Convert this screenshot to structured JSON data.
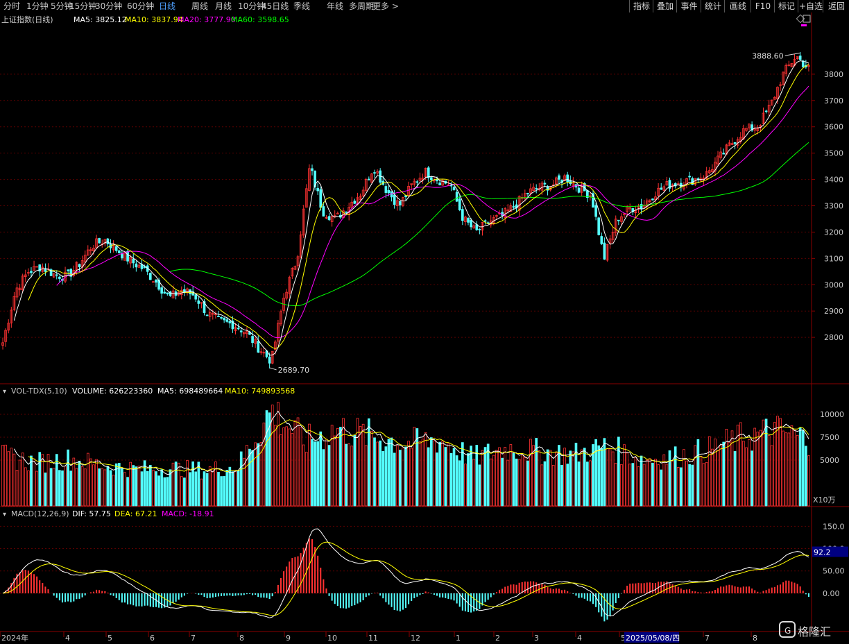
{
  "toolbar": {
    "periods": [
      "分时",
      "1分钟",
      "5分钟",
      "15分钟",
      "30分钟",
      "60分钟",
      "日线",
      "周线",
      "月线",
      "10分钟",
      "45日线",
      "季线",
      "年线",
      "多周期",
      "更多 >"
    ],
    "active_period": "日线",
    "right_buttons": [
      "指标",
      "叠加",
      "事件",
      "统计",
      "画线",
      "F10",
      "标记",
      "+自选",
      "返回"
    ]
  },
  "colors": {
    "up": "#ff3232",
    "down": "#54ffff",
    "ma5": "#ffffff",
    "ma10": "#ffff00",
    "ma20": "#ff00ff",
    "ma60": "#00ff00",
    "grid": "#5a0000",
    "axis_text": "#c8c8c8",
    "active": "#4ea0ff"
  },
  "price_panel": {
    "title": "上证指数(日线)",
    "ma5": "MA5: 3825.12",
    "ma10": "MA10: 3837.94",
    "ma20": "MA20: 3777.90",
    "ma60": "MA60: 3598.65",
    "ticks": [
      "3800",
      "3700",
      "3600",
      "3500",
      "3400",
      "3300",
      "3200",
      "3100",
      "3000",
      "2900",
      "2800"
    ],
    "high_label": "3888.60",
    "low_label": "2689.70"
  },
  "volume_panel": {
    "title": "VOL-TDX(5,10)",
    "volume": "VOLUME: 626223360",
    "ma5": "MA5: 698489664",
    "ma10": "MA10: 749893568",
    "ticks": [
      "10000",
      "7500",
      "5000"
    ],
    "unit": "X10万"
  },
  "macd_panel": {
    "title": "MACD(12,26,9)",
    "dif": "DIF: 57.75",
    "dea": "DEA: 67.21",
    "macd": "MACD: -18.91",
    "ticks": [
      "150.0",
      "100.0",
      "50.00",
      "0.00"
    ],
    "marker": "92.2"
  },
  "x_axis": {
    "labels": [
      "2024年",
      "4",
      "5",
      "6",
      "7",
      "8",
      "9",
      "10",
      "11",
      "12",
      "1",
      "2",
      "3",
      "4",
      "5",
      "7",
      "8"
    ],
    "highlight": "2025/05/08/四"
  },
  "watermark": "格隆汇",
  "chart_data": {
    "type": "candlestick",
    "title": "上证指数(日线)",
    "price_ylim": [
      2650,
      3950
    ],
    "volume_ylim": [
      0,
      12500
    ],
    "macd_ylim": [
      -70,
      180
    ],
    "anchors": [
      {
        "date": "2024-03",
        "close": 2780
      },
      {
        "date": "2024-03",
        "close": 2980
      },
      {
        "date": "2024-03",
        "close": 3050
      },
      {
        "date": "2024-04",
        "close": 3070
      },
      {
        "date": "2024-04",
        "close": 3040
      },
      {
        "date": "2024-04",
        "close": 3030
      },
      {
        "date": "2024-05",
        "close": 3080
      },
      {
        "date": "2024-05",
        "close": 3150
      },
      {
        "date": "2024-05",
        "close": 3170
      },
      {
        "date": "2024-05",
        "close": 3130
      },
      {
        "date": "2024-06",
        "close": 3090
      },
      {
        "date": "2024-06",
        "close": 3060
      },
      {
        "date": "2024-06",
        "close": 3010
      },
      {
        "date": "2024-07",
        "close": 2950
      },
      {
        "date": "2024-07",
        "close": 2980
      },
      {
        "date": "2024-07",
        "close": 2960
      },
      {
        "date": "2024-08",
        "close": 2890
      },
      {
        "date": "2024-08",
        "close": 2860
      },
      {
        "date": "2024-08",
        "close": 2850
      },
      {
        "date": "2024-09",
        "close": 2820
      },
      {
        "date": "2024-09",
        "close": 2760
      },
      {
        "date": "2024-09",
        "close": 2710
      },
      {
        "date": "2024-09",
        "close": 2960
      },
      {
        "date": "2024-09",
        "close": 3100
      },
      {
        "date": "2024-10",
        "close": 3450
      },
      {
        "date": "2024-10",
        "close": 3280
      },
      {
        "date": "2024-10",
        "close": 3250
      },
      {
        "date": "2024-10",
        "close": 3300
      },
      {
        "date": "2024-11",
        "close": 3350
      },
      {
        "date": "2024-11",
        "close": 3450
      },
      {
        "date": "2024-11",
        "close": 3360
      },
      {
        "date": "2024-11",
        "close": 3300
      },
      {
        "date": "2024-12",
        "close": 3380
      },
      {
        "date": "2024-12",
        "close": 3430
      },
      {
        "date": "2024-12",
        "close": 3400
      },
      {
        "date": "2024-12",
        "close": 3380
      },
      {
        "date": "2025-01",
        "close": 3250
      },
      {
        "date": "2025-01",
        "close": 3200
      },
      {
        "date": "2025-01",
        "close": 3240
      },
      {
        "date": "2025-02",
        "close": 3260
      },
      {
        "date": "2025-02",
        "close": 3300
      },
      {
        "date": "2025-02",
        "close": 3350
      },
      {
        "date": "2025-03",
        "close": 3370
      },
      {
        "date": "2025-03",
        "close": 3380
      },
      {
        "date": "2025-03",
        "close": 3410
      },
      {
        "date": "2025-03",
        "close": 3370
      },
      {
        "date": "2025-04",
        "close": 3340
      },
      {
        "date": "2025-04",
        "close": 3100
      },
      {
        "date": "2025-04",
        "close": 3250
      },
      {
        "date": "2025-04",
        "close": 3290
      },
      {
        "date": "2025-05",
        "close": 3300
      },
      {
        "date": "2025-05",
        "close": 3350
      },
      {
        "date": "2025-05",
        "close": 3380
      },
      {
        "date": "2025-06",
        "close": 3390
      },
      {
        "date": "2025-06",
        "close": 3400
      },
      {
        "date": "2025-06",
        "close": 3420
      },
      {
        "date": "2025-07",
        "close": 3480
      },
      {
        "date": "2025-07",
        "close": 3540
      },
      {
        "date": "2025-07",
        "close": 3590
      },
      {
        "date": "2025-08",
        "close": 3600
      },
      {
        "date": "2025-08",
        "close": 3680
      },
      {
        "date": "2025-08",
        "close": 3800
      },
      {
        "date": "2025-08",
        "close": 3870
      },
      {
        "date": "2025-09",
        "close": 3820
      }
    ],
    "volume_anchors": [
      {
        "date": "2024-03",
        "value": 5400
      },
      {
        "date": "2024-04",
        "value": 4700
      },
      {
        "date": "2024-05",
        "value": 5100
      },
      {
        "date": "2024-06",
        "value": 4400
      },
      {
        "date": "2024-07",
        "value": 4000
      },
      {
        "date": "2024-08",
        "value": 4100
      },
      {
        "date": "2024-09",
        "value": 3900
      },
      {
        "date": "2024-09",
        "value": 4300
      },
      {
        "date": "2024-10",
        "value": 10500
      },
      {
        "date": "2024-10",
        "value": 7000
      },
      {
        "date": "2024-11",
        "value": 8400
      },
      {
        "date": "2024-11",
        "value": 7600
      },
      {
        "date": "2024-12",
        "value": 6800
      },
      {
        "date": "2024-12",
        "value": 7200
      },
      {
        "date": "2025-01",
        "value": 5200
      },
      {
        "date": "2025-02",
        "value": 6300
      },
      {
        "date": "2025-03",
        "value": 5900
      },
      {
        "date": "2025-04",
        "value": 5600
      },
      {
        "date": "2025-04",
        "value": 6500
      },
      {
        "date": "2025-05",
        "value": 5100
      },
      {
        "date": "2025-06",
        "value": 5300
      },
      {
        "date": "2025-07",
        "value": 6100
      },
      {
        "date": "2025-08",
        "value": 7400
      },
      {
        "date": "2025-08",
        "value": 8200
      },
      {
        "date": "2025-09",
        "value": 7300
      }
    ]
  }
}
